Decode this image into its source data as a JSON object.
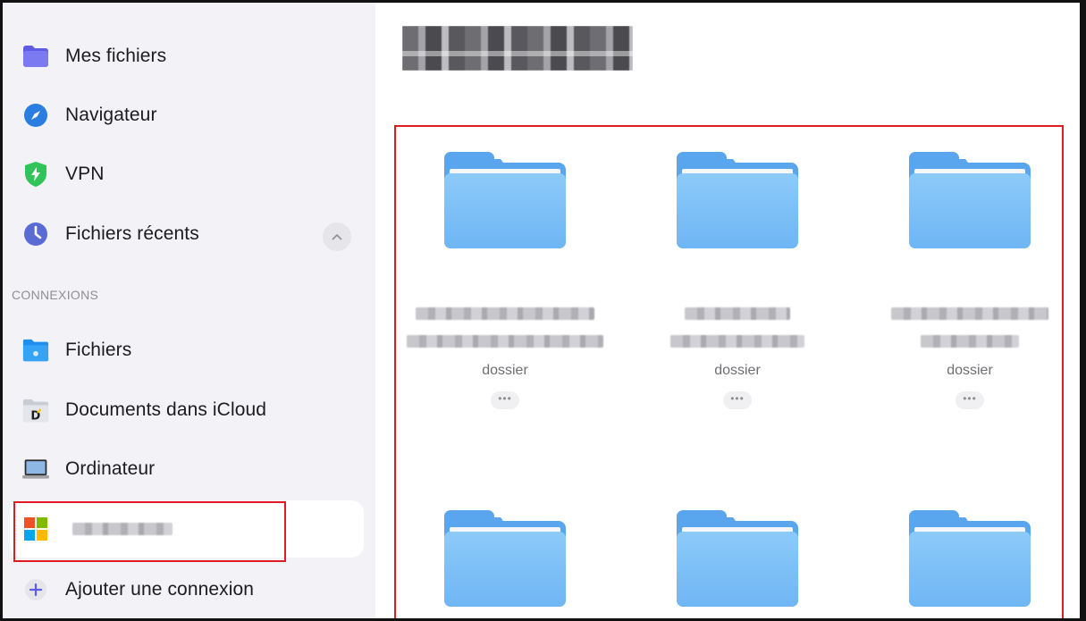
{
  "sidebar": {
    "items": [
      {
        "label": "Mes fichiers",
        "icon": "folder-icon"
      },
      {
        "label": "Navigateur",
        "icon": "compass-icon"
      },
      {
        "label": "VPN",
        "icon": "vpn-shield-icon"
      },
      {
        "label": "Fichiers récents",
        "icon": "clock-icon"
      }
    ],
    "section_header": "CONNEXIONS",
    "connections": [
      {
        "label": "Fichiers",
        "icon": "files-app-icon"
      },
      {
        "label": "Documents dans iCloud",
        "icon": "documents-app-icon"
      },
      {
        "label": "Ordinateur",
        "icon": "laptop-icon"
      },
      {
        "label": "",
        "icon": "microsoft-logo-icon",
        "selected": true
      },
      {
        "label": "Ajouter une connexion",
        "icon": "plus-icon"
      }
    ]
  },
  "main": {
    "title": "",
    "folders": [
      {
        "kind": "dossier",
        "more": "•••"
      },
      {
        "kind": "dossier",
        "more": "•••"
      },
      {
        "kind": "dossier",
        "more": "•••"
      },
      {
        "kind": "",
        "more": ""
      },
      {
        "kind": "",
        "more": ""
      },
      {
        "kind": "",
        "more": ""
      }
    ]
  },
  "colors": {
    "accent": "#007aff",
    "folder_blue": "#6fb6f5",
    "highlight_red": "#e11b22",
    "sidebar_bg": "#f2f2f7"
  }
}
